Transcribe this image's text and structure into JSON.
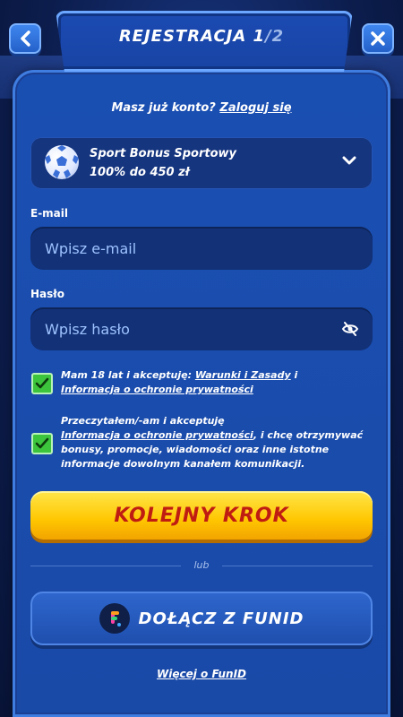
{
  "header": {
    "title_main": "REJESTRACJA 1",
    "title_step": "/2",
    "back_symbol": "‹",
    "close_symbol": "✕"
  },
  "login": {
    "prompt": "Masz już konto?",
    "link": "Zaloguj się"
  },
  "bonus": {
    "name": "Sport Bonus Sportowy",
    "offer": "100% do 450 zł",
    "icon": "soccer-ball-icon"
  },
  "email": {
    "label": "E-mail",
    "placeholder": "Wpisz e-mail"
  },
  "password": {
    "label": "Hasło",
    "placeholder": "Wpisz hasło"
  },
  "consent1": {
    "text_before": "Mam 18 lat i akceptuję: ",
    "link1": "Warunki i Zasady",
    "text_mid": " i",
    "link2": "Informacja o ochronie prywatności",
    "checked": true
  },
  "consent2": {
    "line1": "Przeczytałem/-am i akceptuję",
    "link": "Informacja o ochronie prywatności",
    "text_after": ", i chcę otrzymywać bonusy, promocje, wiadomości oraz inne istotne informacje dowolnym kanałem komunikacji.",
    "checked": true
  },
  "actions": {
    "next_label": "KOLEJNY KROK",
    "or_label": "lub",
    "funid_label": "DOŁĄCZ Z FUNID",
    "more_label": "Więcej o FunID"
  },
  "colors": {
    "panel": "#1a4fb2",
    "accent_yellow": "#ffc600",
    "next_text": "#c01d12",
    "check_green": "#3cc43c"
  }
}
